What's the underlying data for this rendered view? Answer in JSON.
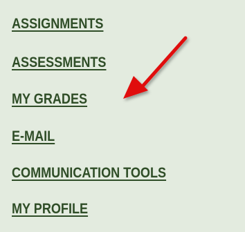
{
  "nav": {
    "items": [
      {
        "label": "ASSIGNMENTS"
      },
      {
        "label": "ASSESSMENTS"
      },
      {
        "label": "MY GRADES"
      },
      {
        "label": "E-MAIL"
      },
      {
        "label": "COMMUNICATION TOOLS"
      },
      {
        "label": "MY PROFILE"
      }
    ]
  },
  "colors": {
    "background": "#e3ebdf",
    "link_text": "#2f4d27",
    "arrow": "#e01010"
  },
  "annotation": {
    "icon": "red-arrow-icon",
    "target": "MY GRADES"
  }
}
